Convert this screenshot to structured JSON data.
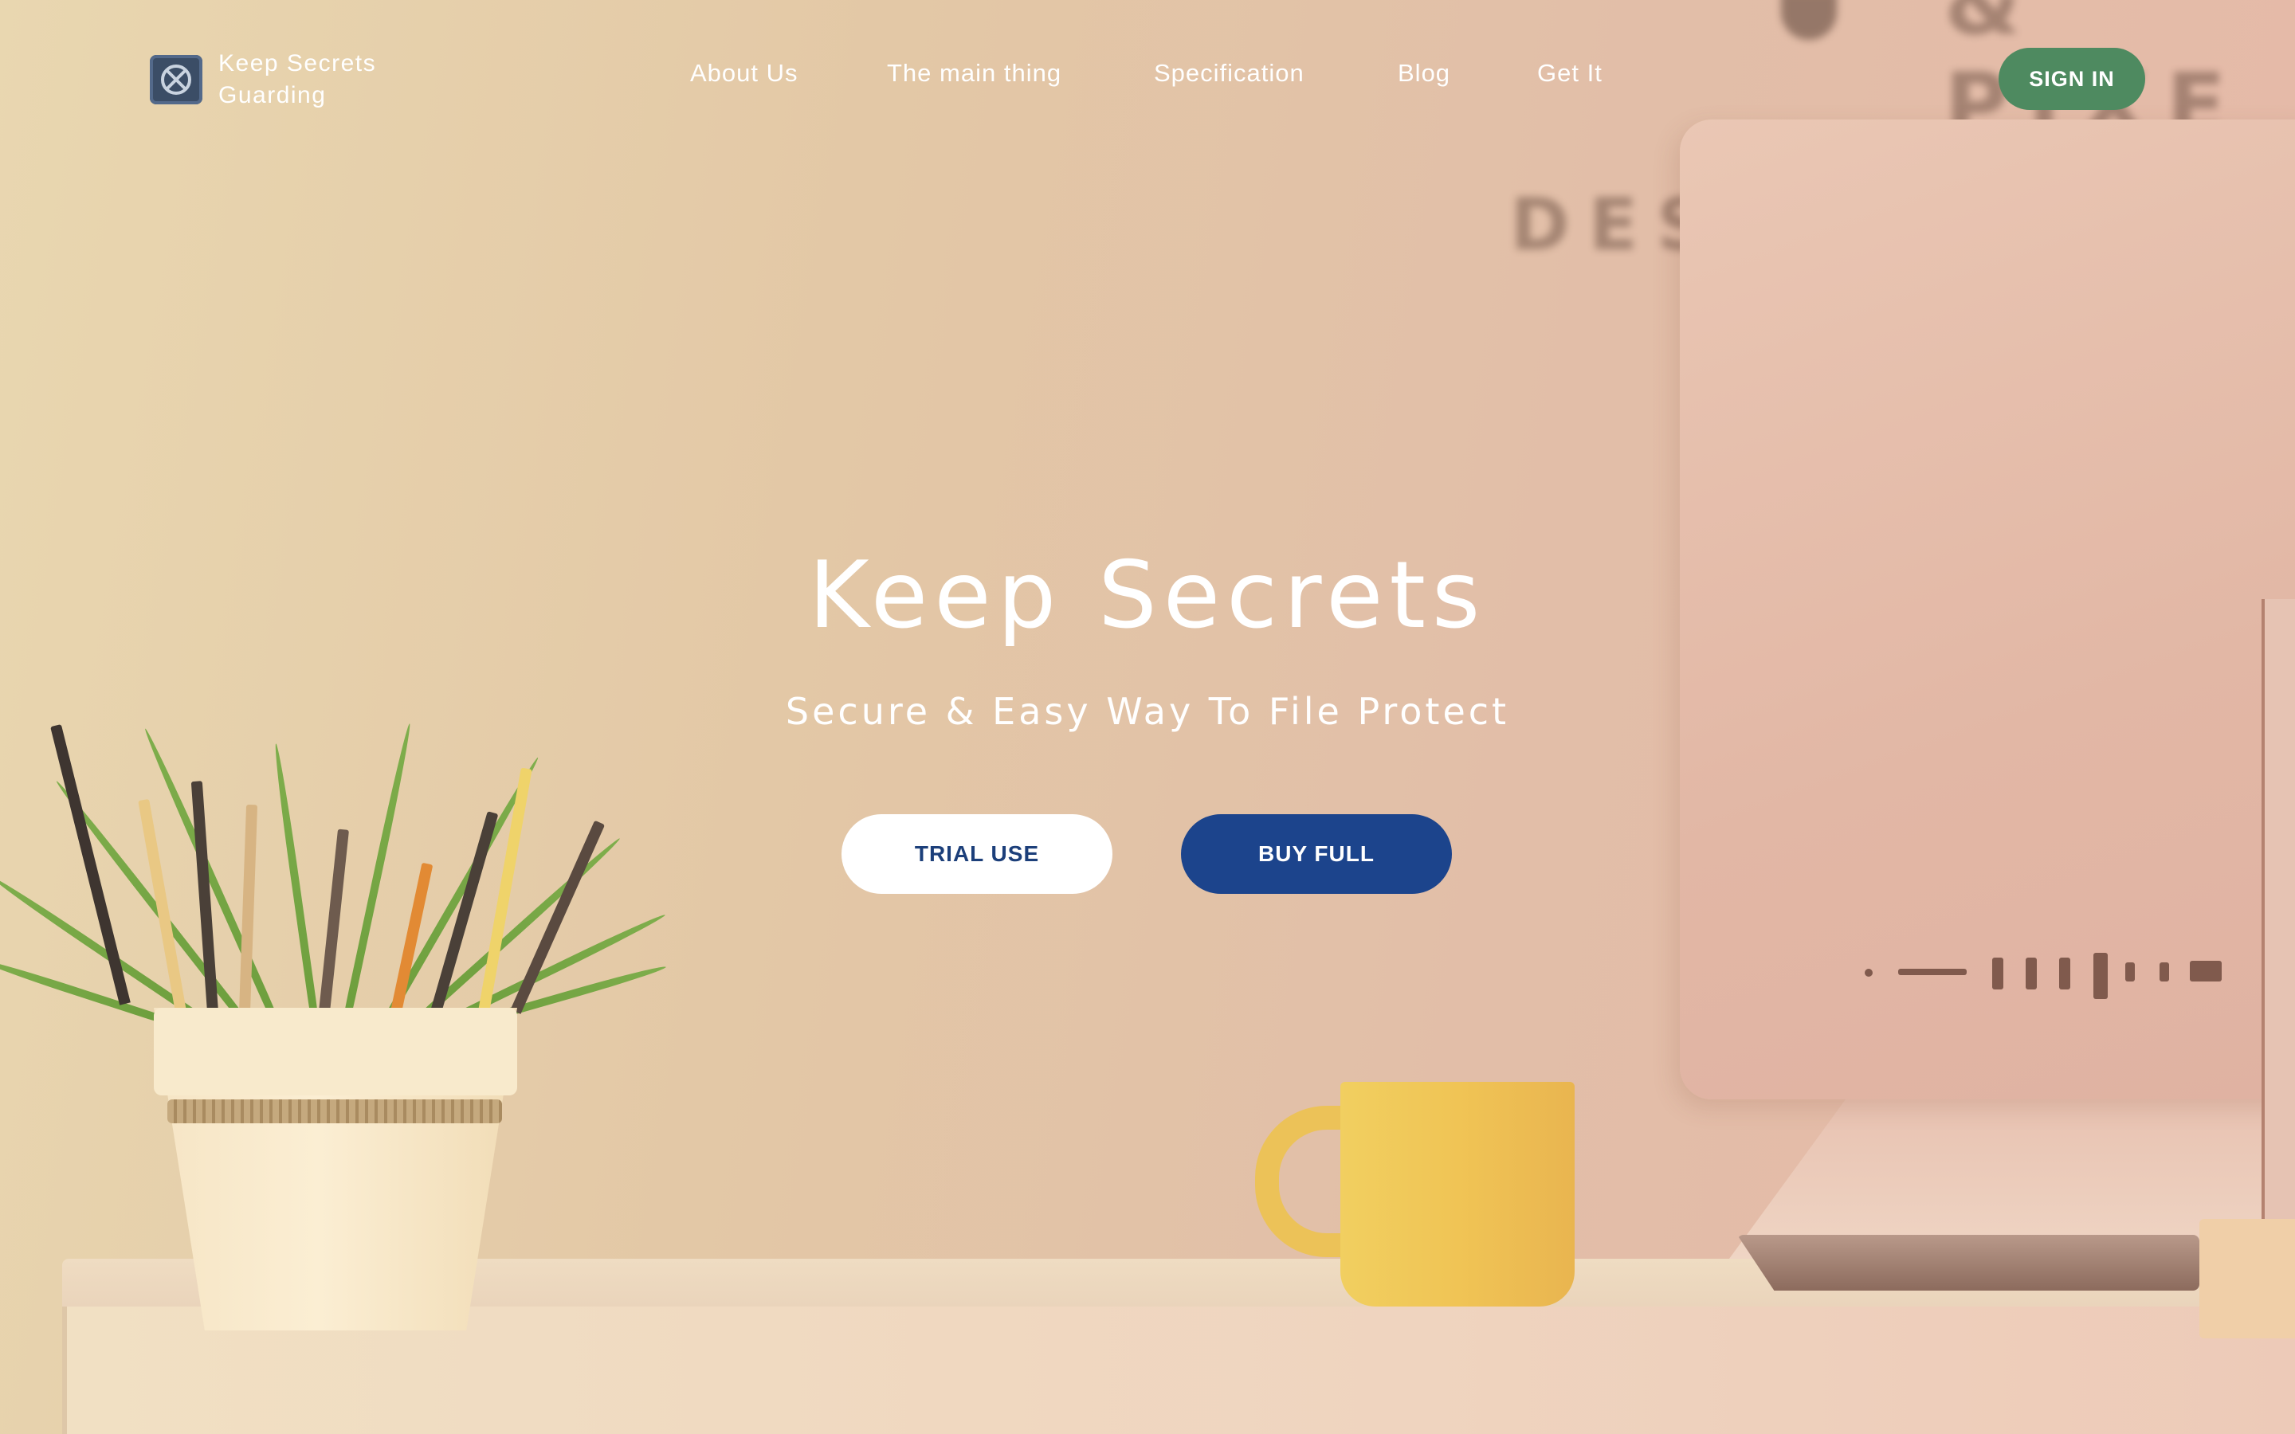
{
  "header": {
    "brand": {
      "name": "Keep Secrets Guarding",
      "logo_icon": "safe-icon"
    },
    "nav": [
      {
        "label": "About Us"
      },
      {
        "label": "The main thing"
      },
      {
        "label": "Specification"
      },
      {
        "label": "Blog"
      },
      {
        "label": "Get It"
      }
    ],
    "sign_in_label": "SIGN IN"
  },
  "hero": {
    "title": "Keep Secrets",
    "subtitle": "Secure & Easy Way To File Protect",
    "trial_label": "TRIAL USE",
    "buy_label": "BUY FULL"
  },
  "background": {
    "wall_text_1": "DES",
    "wall_text_2": "& PIXE"
  },
  "colors": {
    "sign_in_bg": "#4e8a60",
    "buy_bg": "#1c448c",
    "trial_text": "#1c3f7a"
  }
}
